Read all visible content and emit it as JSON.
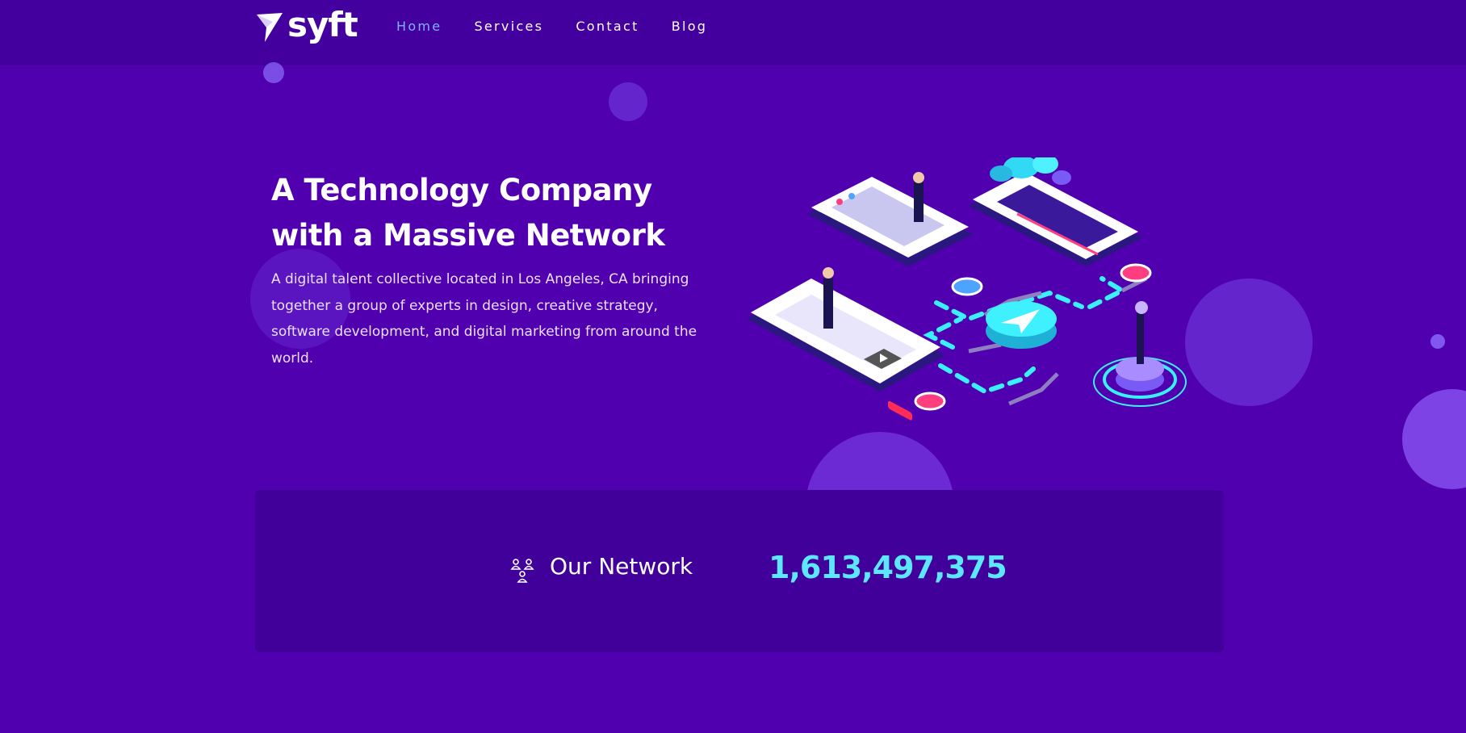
{
  "brand": {
    "name": "syft",
    "logo_icon": "paper-plane-icon"
  },
  "nav": {
    "items": [
      {
        "label": "Home",
        "active": true
      },
      {
        "label": "Services",
        "active": false
      },
      {
        "label": "Contact",
        "active": false
      },
      {
        "label": "Blog",
        "active": false
      }
    ]
  },
  "hero": {
    "title_line1": "A Technology Company",
    "title_line2": "with a Massive Network",
    "description": "A digital talent collective located in Los Angeles, CA bringing together a group of experts in design, creative strategy, software development, and digital marketing from around the world.",
    "illustration": "isometric-network-illustration"
  },
  "stats": {
    "icon": "people-network-icon",
    "label": "Our Network",
    "value": "1,613,497,375"
  },
  "colors": {
    "background": "#5100b0",
    "header": "#44009e",
    "panel": "#41009a",
    "nav_active": "#7fb2ff",
    "accent_cyan": "#5de7ff"
  }
}
